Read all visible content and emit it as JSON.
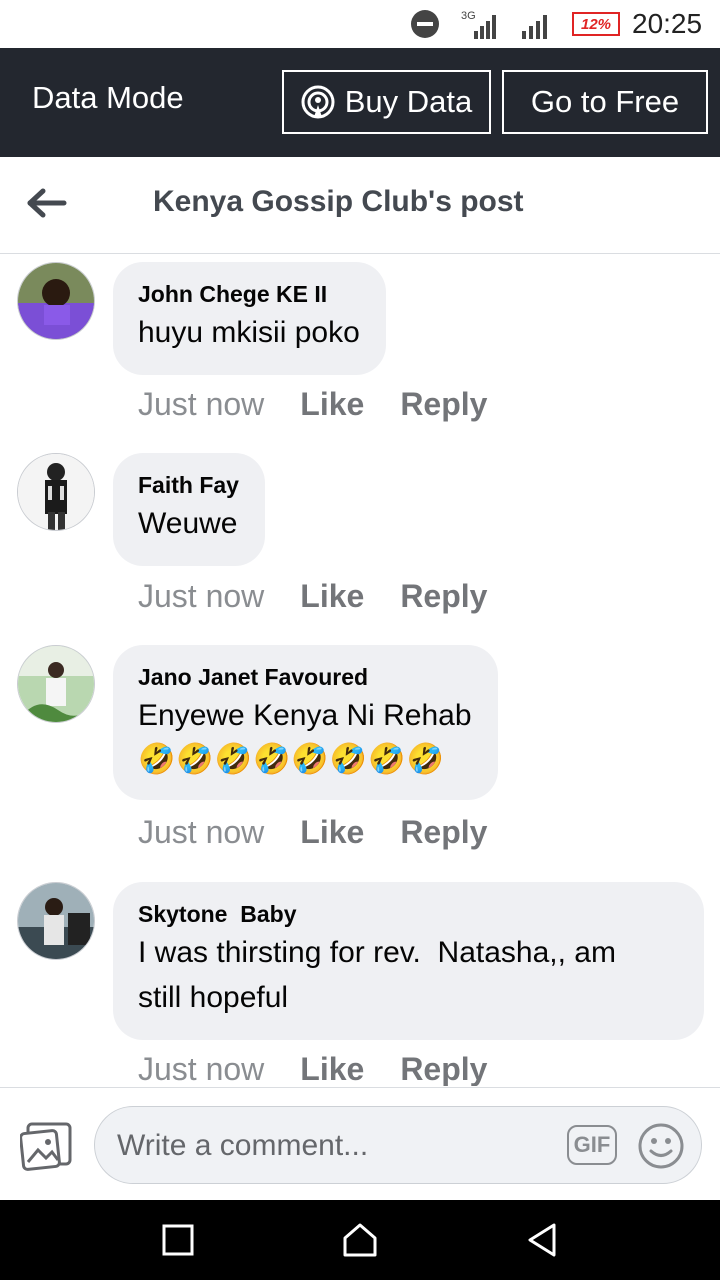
{
  "status_bar": {
    "network_label": "3G",
    "battery_text": "12%",
    "time": "20:25"
  },
  "data_mode": {
    "label": "Data Mode",
    "buy_data": "Buy Data",
    "go_to_free": "Go to Free"
  },
  "header": {
    "title": "Kenya Gossip Club's post"
  },
  "comments": [
    {
      "author": "John Chege KE II",
      "text": "huyu mkisii poko",
      "time": "Just now",
      "like": "Like",
      "reply": "Reply"
    },
    {
      "author": "Faith Fay",
      "text": "Weuwe",
      "time": "Just now",
      "like": "Like",
      "reply": "Reply"
    },
    {
      "author": "Jano Janet Favoured",
      "text": "Enyewe Kenya Ni Rehab",
      "emoji": "🤣🤣🤣🤣🤣🤣🤣🤣",
      "time": "Just now",
      "like": "Like",
      "reply": "Reply"
    },
    {
      "author": "Skytone  Baby",
      "text_line1": "I was thirsting for rev.  Natasha,, am",
      "text_line2": "still hopeful",
      "time": "Just now",
      "like": "Like",
      "reply": "Reply"
    }
  ],
  "composer": {
    "placeholder": "Write a comment...",
    "gif_label": "GIF"
  },
  "icons": {
    "dnd": "do-not-disturb-icon",
    "signal": "signal-icon",
    "battery": "battery-icon",
    "back": "back-arrow-icon",
    "photo": "photo-icon",
    "emoji": "emoji-icon"
  },
  "colors": {
    "data_bar": "#23272f",
    "bubble": "#eff0f3",
    "battery_low": "#e02424"
  }
}
